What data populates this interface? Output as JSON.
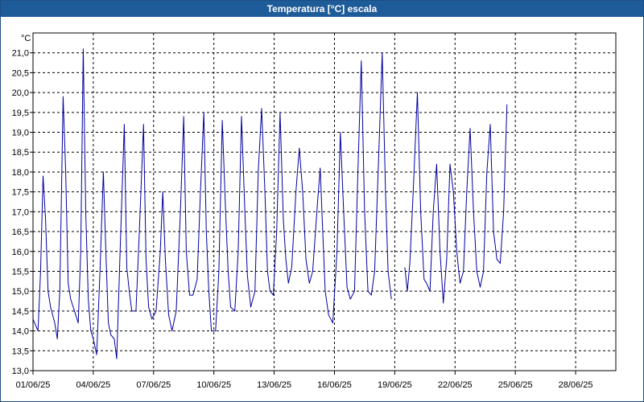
{
  "window": {
    "title": "Temperatura [°C] escala"
  },
  "colors": {
    "title_bar": "#1e5b99",
    "series": "#0000a0",
    "grid": "#000000",
    "background": "#ffffff"
  },
  "chart_data": {
    "type": "line",
    "title": "Temperatura [°C] escala",
    "ylabel": "°C",
    "xlabel": "",
    "ylim": [
      13.0,
      21.5
    ],
    "xlim": [
      "2025-06-01",
      "2025-06-30"
    ],
    "grid": true,
    "legend": "none",
    "y_ticks": [
      "13,0",
      "13,5",
      "14,0",
      "14,5",
      "15,0",
      "15,5",
      "16,0",
      "16,5",
      "17,0",
      "17,5",
      "18,0",
      "18,5",
      "19,0",
      "19,5",
      "20,0",
      "20,5",
      "21,0"
    ],
    "x_ticks": [
      "01/06/25",
      "04/06/25",
      "07/06/25",
      "10/06/25",
      "13/06/25",
      "16/06/25",
      "19/06/25",
      "22/06/25",
      "25/06/25",
      "28/06/25"
    ],
    "series": [
      {
        "points": [
          [
            "01/06/25 00:00",
            14.3
          ],
          [
            "01/06/25 06:00",
            14.0
          ],
          [
            "01/06/25 09:00",
            15.5
          ],
          [
            "01/06/25 12:00",
            17.9
          ],
          [
            "01/06/25 15:00",
            16.8
          ],
          [
            "01/06/25 18:00",
            15.0
          ],
          [
            "01/06/25 21:00",
            14.6
          ],
          [
            "02/06/25 02:00",
            14.2
          ],
          [
            "02/06/25 05:00",
            13.8
          ],
          [
            "02/06/25 08:00",
            15.0
          ],
          [
            "02/06/25 12:00",
            19.9
          ],
          [
            "02/06/25 15:00",
            18.0
          ],
          [
            "02/06/25 18:00",
            15.2
          ],
          [
            "02/06/25 21:00",
            14.8
          ],
          [
            "03/06/25 03:00",
            14.4
          ],
          [
            "03/06/25 06:00",
            14.2
          ],
          [
            "03/06/25 09:00",
            16.0
          ],
          [
            "03/06/25 12:00",
            21.1
          ],
          [
            "03/06/25 15:00",
            17.0
          ],
          [
            "03/06/25 18:00",
            14.8
          ],
          [
            "03/06/25 21:00",
            14.0
          ],
          [
            "04/06/25 00:00",
            13.8
          ],
          [
            "04/06/25 04:00",
            13.4
          ],
          [
            "04/06/25 08:00",
            15.5
          ],
          [
            "04/06/25 12:00",
            18.0
          ],
          [
            "04/06/25 15:00",
            16.0
          ],
          [
            "04/06/25 18:00",
            14.2
          ],
          [
            "04/06/25 21:00",
            13.9
          ],
          [
            "05/06/25 01:00",
            13.8
          ],
          [
            "05/06/25 04:00",
            13.3
          ],
          [
            "05/06/25 08:00",
            16.0
          ],
          [
            "05/06/25 13:00",
            19.2
          ],
          [
            "05/06/25 16:00",
            15.6
          ],
          [
            "05/06/25 19:00",
            15.0
          ],
          [
            "05/06/25 22:00",
            14.5
          ],
          [
            "06/06/25 03:00",
            14.5
          ],
          [
            "06/06/25 07:00",
            16.5
          ],
          [
            "06/06/25 12:00",
            19.2
          ],
          [
            "06/06/25 15:00",
            15.8
          ],
          [
            "06/06/25 18:00",
            14.6
          ],
          [
            "06/06/25 22:00",
            14.3
          ],
          [
            "07/06/25 03:00",
            14.5
          ],
          [
            "07/06/25 08:00",
            16.0
          ],
          [
            "07/06/25 11:00",
            17.5
          ],
          [
            "07/06/25 14:00",
            15.8
          ],
          [
            "07/06/25 18:00",
            14.4
          ],
          [
            "07/06/25 22:00",
            14.0
          ],
          [
            "08/06/25 03:00",
            14.5
          ],
          [
            "08/06/25 08:00",
            17.0
          ],
          [
            "08/06/25 12:00",
            19.4
          ],
          [
            "08/06/25 15:00",
            16.0
          ],
          [
            "08/06/25 19:00",
            14.9
          ],
          [
            "08/06/25 23:00",
            14.9
          ],
          [
            "09/06/25 04:00",
            15.3
          ],
          [
            "09/06/25 08:00",
            17.5
          ],
          [
            "09/06/25 12:00",
            19.5
          ],
          [
            "09/06/25 15:00",
            16.5
          ],
          [
            "09/06/25 18:00",
            15.0
          ],
          [
            "09/06/25 21:00",
            14.0
          ],
          [
            "10/06/25 02:00",
            14.0
          ],
          [
            "10/06/25 06:00",
            15.5
          ],
          [
            "10/06/25 10:00",
            19.3
          ],
          [
            "10/06/25 14:00",
            17.0
          ],
          [
            "10/06/25 17:00",
            15.5
          ],
          [
            "10/06/25 20:00",
            14.6
          ],
          [
            "11/06/25 01:00",
            14.5
          ],
          [
            "11/06/25 05:00",
            16.0
          ],
          [
            "11/06/25 09:00",
            19.4
          ],
          [
            "11/06/25 13:00",
            17.0
          ],
          [
            "11/06/25 16:00",
            15.4
          ],
          [
            "11/06/25 20:00",
            14.6
          ],
          [
            "12/06/25 01:00",
            15.0
          ],
          [
            "12/06/25 05:00",
            18.0
          ],
          [
            "12/06/25 09:00",
            19.6
          ],
          [
            "12/06/25 13:00",
            17.5
          ],
          [
            "12/06/25 16:00",
            15.5
          ],
          [
            "12/06/25 19:00",
            15.0
          ],
          [
            "12/06/25 23:00",
            14.9
          ],
          [
            "13/06/25 03:00",
            16.5
          ],
          [
            "13/06/25 07:00",
            19.5
          ],
          [
            "13/06/25 11:00",
            16.8
          ],
          [
            "13/06/25 14:00",
            15.8
          ],
          [
            "13/06/25 17:00",
            15.2
          ],
          [
            "13/06/25 21:00",
            15.6
          ],
          [
            "14/06/25 02:00",
            17.5
          ],
          [
            "14/06/25 06:00",
            18.6
          ],
          [
            "14/06/25 10:00",
            17.5
          ],
          [
            "14/06/25 14:00",
            15.8
          ],
          [
            "14/06/25 18:00",
            15.2
          ],
          [
            "14/06/25 22:00",
            15.5
          ],
          [
            "15/06/25 04:00",
            17.3
          ],
          [
            "15/06/25 07:00",
            18.1
          ],
          [
            "15/06/25 09:00",
            17.0
          ],
          [
            "15/06/25 13:00",
            15.0
          ],
          [
            "15/06/25 17:00",
            14.4
          ],
          [
            "15/06/25 22:00",
            14.2
          ],
          [
            "16/06/25 03:00",
            16.0
          ],
          [
            "16/06/25 07:00",
            19.0
          ],
          [
            "16/06/25 11:00",
            17.0
          ],
          [
            "16/06/25 15:00",
            15.1
          ],
          [
            "16/06/25 19:00",
            14.8
          ],
          [
            "17/06/25 00:00",
            15.0
          ],
          [
            "17/06/25 04:00",
            18.0
          ],
          [
            "17/06/25 08:00",
            20.8
          ],
          [
            "17/06/25 12:00",
            17.0
          ],
          [
            "17/06/25 16:00",
            15.0
          ],
          [
            "17/06/25 20:00",
            14.9
          ],
          [
            "18/06/25 00:00",
            15.5
          ],
          [
            "18/06/25 05:00",
            18.5
          ],
          [
            "18/06/25 09:00",
            21.0
          ],
          [
            "18/06/25 13:00",
            17.5
          ],
          [
            "18/06/25 16:00",
            15.5
          ],
          [
            "18/06/25 20:00",
            14.8
          ]
        ]
      },
      {
        "points": [
          [
            "19/06/25 12:00",
            15.6
          ],
          [
            "19/06/25 15:00",
            15.0
          ],
          [
            "19/06/25 18:00",
            15.7
          ],
          [
            "19/06/25 22:00",
            17.5
          ],
          [
            "20/06/25 03:00",
            20.0
          ],
          [
            "20/06/25 07:00",
            17.0
          ],
          [
            "20/06/25 11:00",
            15.3
          ],
          [
            "20/06/25 14:00",
            15.2
          ],
          [
            "20/06/25 18:00",
            15.0
          ],
          [
            "20/06/25 22:00",
            17.0
          ],
          [
            "21/06/25 02:00",
            18.2
          ],
          [
            "21/06/25 06:00",
            16.0
          ],
          [
            "21/06/25 10:00",
            14.7
          ],
          [
            "21/06/25 14:00",
            15.8
          ],
          [
            "21/06/25 18:00",
            18.2
          ],
          [
            "21/06/25 22:00",
            17.5
          ],
          [
            "22/06/25 02:00",
            16.0
          ],
          [
            "22/06/25 06:00",
            15.2
          ],
          [
            "22/06/25 10:00",
            15.5
          ],
          [
            "22/06/25 14:00",
            17.5
          ],
          [
            "22/06/25 18:00",
            19.1
          ],
          [
            "22/06/25 22:00",
            17.0
          ],
          [
            "23/06/25 02:00",
            15.5
          ],
          [
            "23/06/25 06:00",
            15.1
          ],
          [
            "23/06/25 10:00",
            15.5
          ],
          [
            "23/06/25 14:00",
            18.0
          ],
          [
            "23/06/25 18:00",
            19.2
          ],
          [
            "23/06/25 22:00",
            16.5
          ],
          [
            "24/06/25 02:00",
            15.8
          ],
          [
            "24/06/25 06:00",
            15.7
          ],
          [
            "24/06/25 10:00",
            17.0
          ],
          [
            "24/06/25 14:00",
            19.7
          ]
        ]
      }
    ]
  }
}
